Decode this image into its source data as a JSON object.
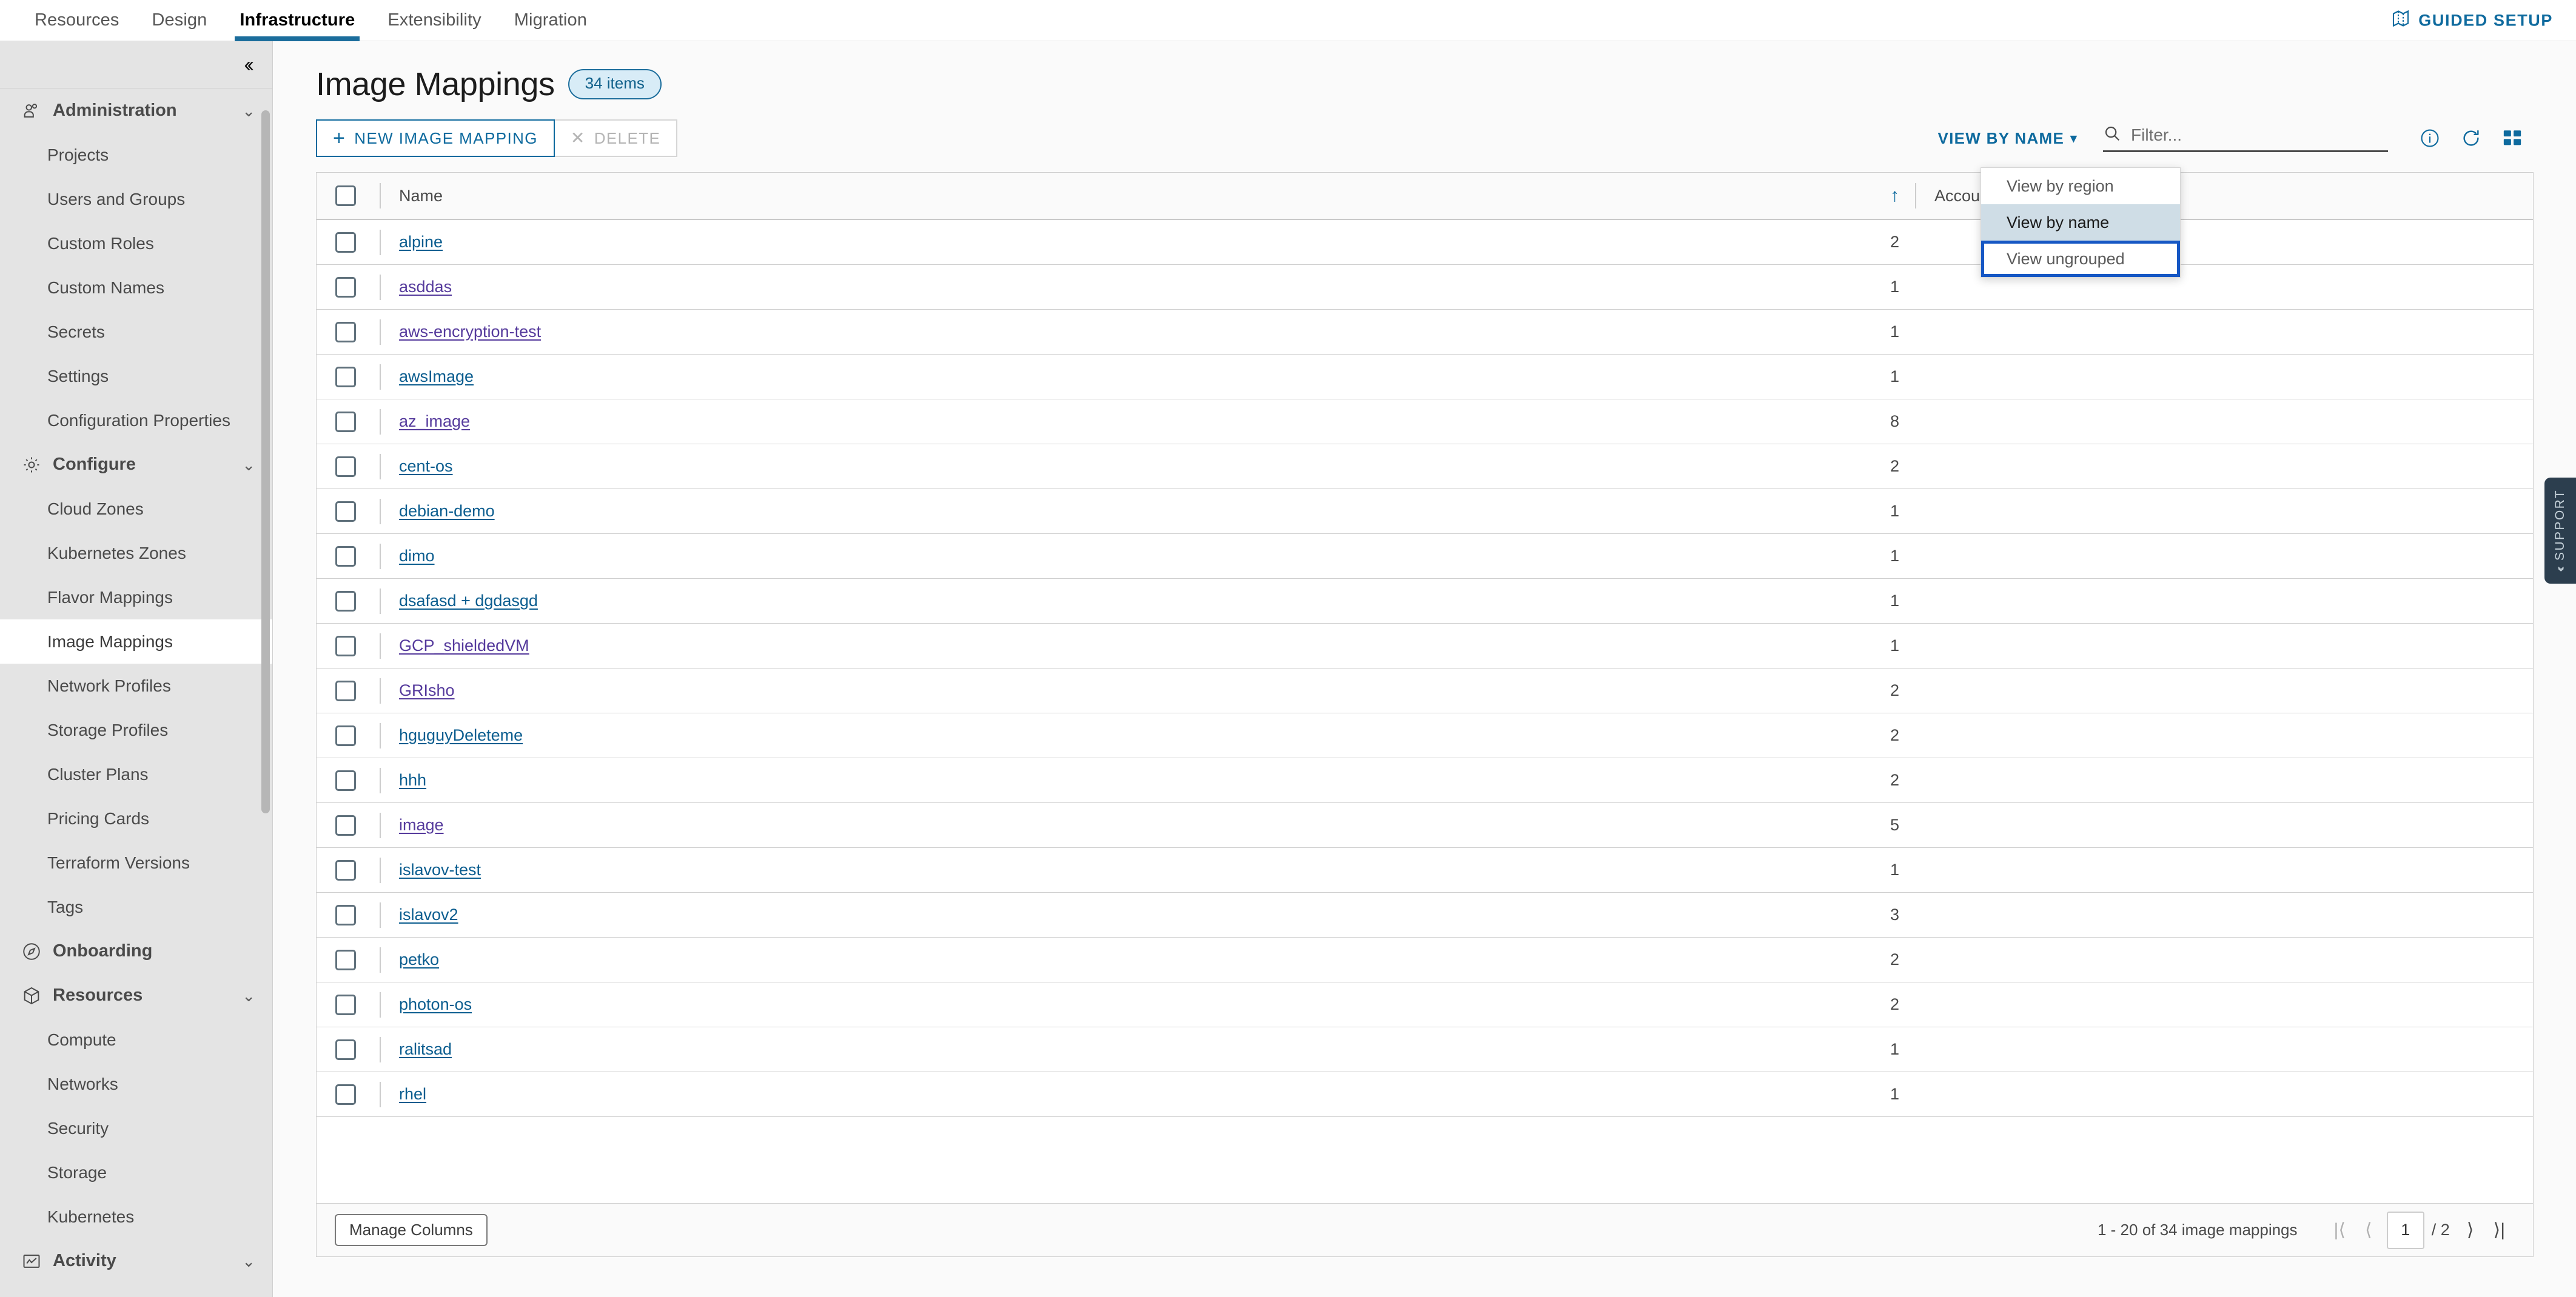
{
  "topnav": {
    "tabs": [
      {
        "label": "Resources",
        "active": false
      },
      {
        "label": "Design",
        "active": false
      },
      {
        "label": "Infrastructure",
        "active": true
      },
      {
        "label": "Extensibility",
        "active": false
      },
      {
        "label": "Migration",
        "active": false
      }
    ],
    "guided_setup_label": "GUIDED SETUP",
    "guided_setup_icon": "map-icon",
    "accent_color": "#0e6a9e"
  },
  "sidebar": {
    "collapse_icon": "chevron-double-left-icon",
    "groups": [
      {
        "label": "Administration",
        "icon": "users-icon",
        "chevron": "chevron-down-icon",
        "items": [
          "Projects",
          "Users and Groups",
          "Custom Roles",
          "Custom Names",
          "Secrets",
          "Settings",
          "Configuration Properties"
        ]
      },
      {
        "label": "Configure",
        "icon": "gear-icon",
        "chevron": "chevron-down-icon",
        "items": [
          "Cloud Zones",
          "Kubernetes Zones",
          "Flavor Mappings",
          "Image Mappings",
          "Network Profiles",
          "Storage Profiles",
          "Cluster Plans",
          "Pricing Cards",
          "Terraform Versions",
          "Tags"
        ]
      },
      {
        "label": "Onboarding",
        "icon": "compass-icon",
        "chevron": "",
        "items": []
      },
      {
        "label": "Resources",
        "icon": "cube-icon",
        "chevron": "chevron-down-icon",
        "items": [
          "Compute",
          "Networks",
          "Security",
          "Storage",
          "Kubernetes"
        ]
      },
      {
        "label": "Activity",
        "icon": "chart-icon",
        "chevron": "chevron-down-icon",
        "items": []
      }
    ],
    "selected_item": "Image Mappings"
  },
  "page": {
    "title": "Image Mappings",
    "items_badge": "34 items"
  },
  "toolbar": {
    "new_button_label": "NEW IMAGE MAPPING",
    "new_button_icon": "plus-icon",
    "delete_button_label": "DELETE",
    "delete_button_icon": "close-icon",
    "view_by_label": "VIEW BY NAME",
    "view_by_chevron": "chevron-down-icon",
    "filter_placeholder": "Filter...",
    "filter_value": "",
    "search_icon": "search-icon",
    "icons": [
      "info-icon",
      "refresh-icon",
      "card-view-icon"
    ]
  },
  "dropdown": {
    "open": true,
    "options": [
      {
        "label": "View by region",
        "selected": false,
        "focused": false
      },
      {
        "label": "View by name",
        "selected": true,
        "focused": false
      },
      {
        "label": "View ungrouped",
        "selected": false,
        "focused": true
      }
    ]
  },
  "table": {
    "columns": [
      "Name",
      "Account / Regions"
    ],
    "sort_column": "Name",
    "sort_direction": "asc",
    "sort_icon": "arrow-up-icon",
    "header_checkbox_checked": false,
    "rows": [
      {
        "name": "alpine",
        "accounts": "2",
        "visited": false
      },
      {
        "name": "asddas",
        "accounts": "1",
        "visited": true
      },
      {
        "name": "aws-encryption-test",
        "accounts": "1",
        "visited": true
      },
      {
        "name": "awsImage",
        "accounts": "1",
        "visited": false
      },
      {
        "name": "az_image",
        "accounts": "8",
        "visited": true
      },
      {
        "name": "cent-os",
        "accounts": "2",
        "visited": false
      },
      {
        "name": "debian-demo",
        "accounts": "1",
        "visited": false
      },
      {
        "name": "dimo",
        "accounts": "1",
        "visited": false
      },
      {
        "name": "dsafasd + dgdasgd",
        "accounts": "1",
        "visited": false
      },
      {
        "name": "GCP_shieldedVM",
        "accounts": "1",
        "visited": true
      },
      {
        "name": "GRIsho",
        "accounts": "2",
        "visited": true
      },
      {
        "name": "hguguyDeleteme",
        "accounts": "2",
        "visited": false
      },
      {
        "name": "hhh",
        "accounts": "2",
        "visited": false
      },
      {
        "name": "image",
        "accounts": "5",
        "visited": true
      },
      {
        "name": "islavov-test",
        "accounts": "1",
        "visited": false
      },
      {
        "name": "islavov2",
        "accounts": "3",
        "visited": false
      },
      {
        "name": "petko",
        "accounts": "2",
        "visited": false
      },
      {
        "name": "photon-os",
        "accounts": "2",
        "visited": false
      },
      {
        "name": "ralitsad",
        "accounts": "1",
        "visited": false
      },
      {
        "name": "rhel",
        "accounts": "1",
        "visited": false
      }
    ]
  },
  "footer": {
    "manage_columns_label": "Manage Columns",
    "range_text": "1 - 20 of 34 image mappings",
    "current_page": "1",
    "total_pages": "/ 2",
    "first_icon": "page-first-icon",
    "prev_icon": "page-prev-icon",
    "next_icon": "page-next-icon",
    "last_icon": "page-last-icon"
  },
  "support": {
    "label": "SUPPORT",
    "chevron": "chevron-double-left-icon"
  }
}
